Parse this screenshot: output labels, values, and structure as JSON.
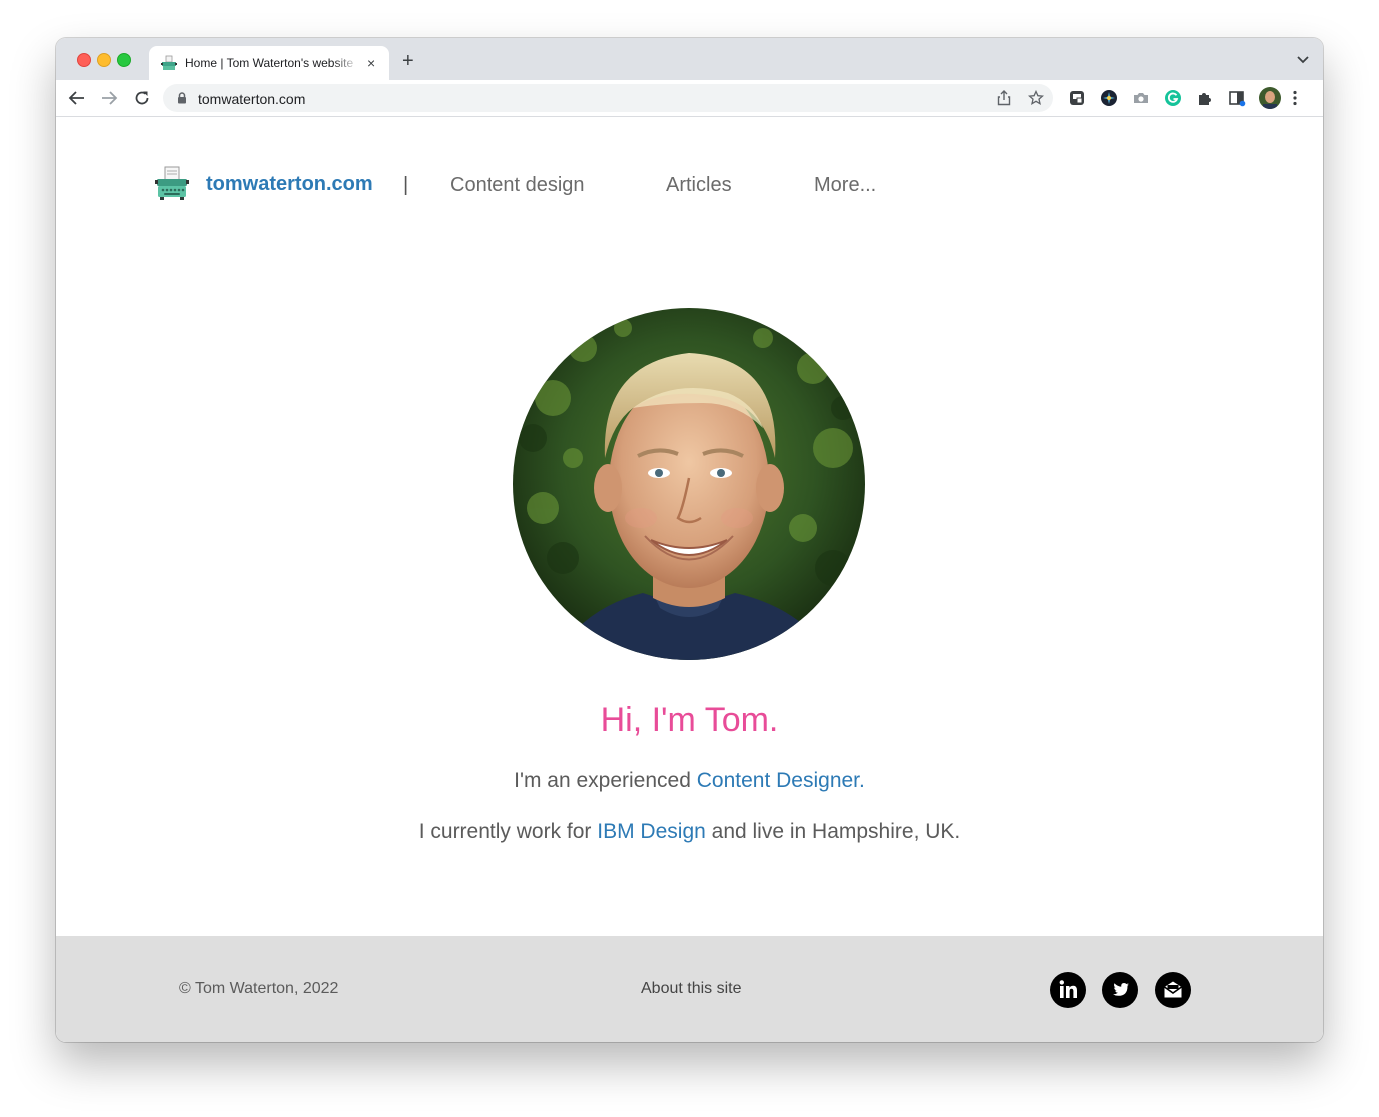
{
  "browser": {
    "tab": {
      "title": "Home | Tom Waterton's website",
      "close_glyph": "×"
    },
    "new_tab_glyph": "+",
    "address": {
      "url": "tomwaterton.com"
    }
  },
  "site": {
    "logo_text": "tomwaterton.com",
    "nav_separator": "|",
    "nav": [
      {
        "label": "Content design"
      },
      {
        "label": "Articles"
      },
      {
        "label": "More..."
      }
    ]
  },
  "hero": {
    "greeting": "Hi, I'm Tom.",
    "line1": {
      "prefix": "I'm an experienced ",
      "link": "Content Designer",
      "suffix": "."
    },
    "line2": {
      "prefix": "I currently work for ",
      "link": "IBM Design",
      "suffix": " and live in Hampshire, UK."
    }
  },
  "footer": {
    "copyright": "© Tom Waterton, 2022",
    "about_link": "About this site",
    "social": [
      "linkedin-icon",
      "twitter-icon",
      "email-icon"
    ]
  },
  "colors": {
    "brand_link": "#2d7ab5",
    "greeting": "#e84c98",
    "footer_bg": "#dedede"
  }
}
